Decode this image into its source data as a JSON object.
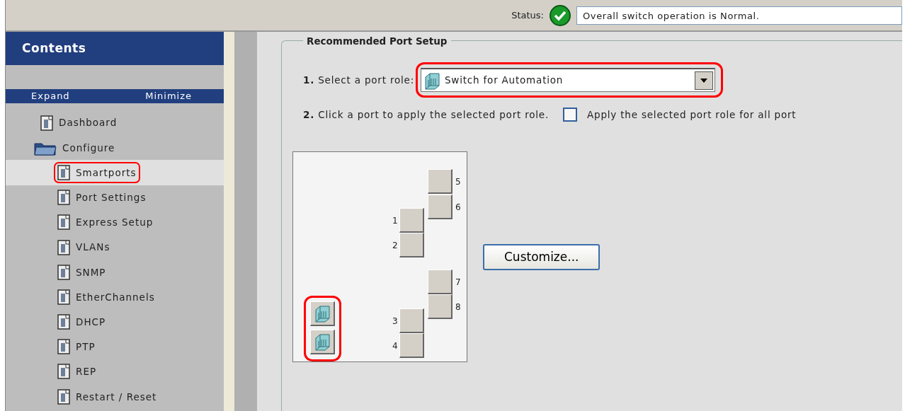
{
  "status": {
    "label": "Status:",
    "ok": true,
    "message": "Overall switch operation is Normal."
  },
  "sidebar": {
    "title": "Contents",
    "actions": [
      "Expand",
      "Minimize"
    ],
    "items": [
      {
        "label": "Dashboard",
        "kind": "page",
        "selected": false,
        "highlighted": false
      },
      {
        "label": "Configure",
        "kind": "folder",
        "expanded": true,
        "selected": false,
        "highlighted": false,
        "children": [
          {
            "label": "Smartports",
            "kind": "page",
            "selected": true,
            "highlighted": true
          },
          {
            "label": "Port Settings",
            "kind": "page",
            "selected": false,
            "highlighted": false
          },
          {
            "label": "Express Setup",
            "kind": "page",
            "selected": false,
            "highlighted": false
          },
          {
            "label": "VLANs",
            "kind": "page",
            "selected": false,
            "highlighted": false
          },
          {
            "label": "SNMP",
            "kind": "page",
            "selected": false,
            "highlighted": false
          },
          {
            "label": "EtherChannels",
            "kind": "page",
            "selected": false,
            "highlighted": false
          },
          {
            "label": "DHCP",
            "kind": "page",
            "selected": false,
            "highlighted": false
          },
          {
            "label": "PTP",
            "kind": "page",
            "selected": false,
            "highlighted": false
          },
          {
            "label": "REP",
            "kind": "page",
            "selected": false,
            "highlighted": false
          },
          {
            "label": "Restart / Reset",
            "kind": "page",
            "selected": false,
            "highlighted": false
          }
        ]
      }
    ]
  },
  "setup": {
    "title": "Recommended Port Setup",
    "step1": {
      "number": "1.",
      "text": "Select a port role:",
      "value": "Switch for Automation",
      "highlighted": true
    },
    "step2": {
      "number": "2.",
      "text": "Click a port to apply the selected port role.",
      "checkbox_label": "Apply the selected port role for all port",
      "checked": false
    },
    "ports": [
      {
        "label": "5",
        "assigned": false
      },
      {
        "label": "6",
        "assigned": false
      },
      {
        "label": "1",
        "assigned": false
      },
      {
        "label": "2",
        "assigned": false
      },
      {
        "label": "7",
        "assigned": false
      },
      {
        "label": "8",
        "assigned": false
      },
      {
        "label": "3",
        "assigned": false
      },
      {
        "label": "4",
        "assigned": false
      },
      {
        "assigned": true
      },
      {
        "assigned": true
      }
    ],
    "customize_button": "Customize..."
  }
}
